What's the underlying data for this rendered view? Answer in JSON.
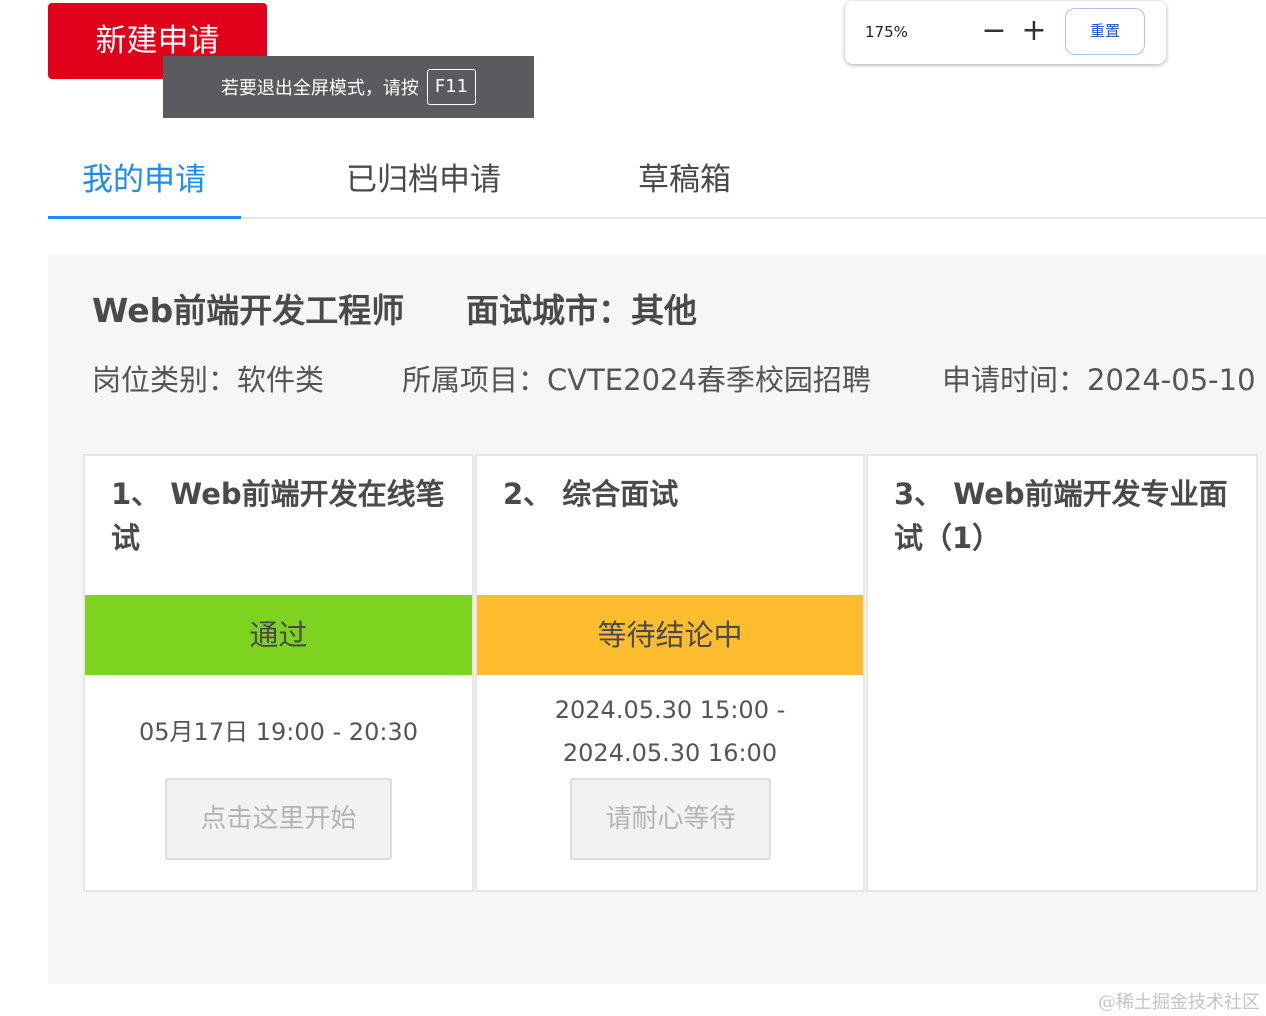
{
  "header": {
    "new_button": "新建申请"
  },
  "fullscreen_toast": {
    "message": "若要退出全屏模式，请按",
    "key": "F11"
  },
  "zoom": {
    "level": "175%",
    "minus": "−",
    "plus": "+",
    "reset": "重置"
  },
  "tabs": [
    {
      "label": "我的申请",
      "active": true
    },
    {
      "label": "已归档申请",
      "active": false
    },
    {
      "label": "草稿箱",
      "active": false
    }
  ],
  "application": {
    "job_title": "Web前端开发工程师",
    "city": "面试城市：其他",
    "category": "岗位类别：软件类",
    "project": "所属项目：CVTE2024春季校园招聘",
    "applied": "申请时间：2024-05-10"
  },
  "stages": [
    {
      "title": "1、 Web前端开发在线笔试",
      "status": "通过",
      "status_color": "#7ed321",
      "time": "05月17日 19:00 - 20:30",
      "button": "点击这里开始"
    },
    {
      "title": "2、 综合面试",
      "status": "等待结论中",
      "status_color": "#fdbd2e",
      "time": "2024.05.30 15:00 - 2024.05.30 16:00",
      "button": "请耐心等待"
    },
    {
      "title": "3、 Web前端开发专业面试（1）"
    }
  ],
  "watermark": "@稀土掘金技术社区"
}
